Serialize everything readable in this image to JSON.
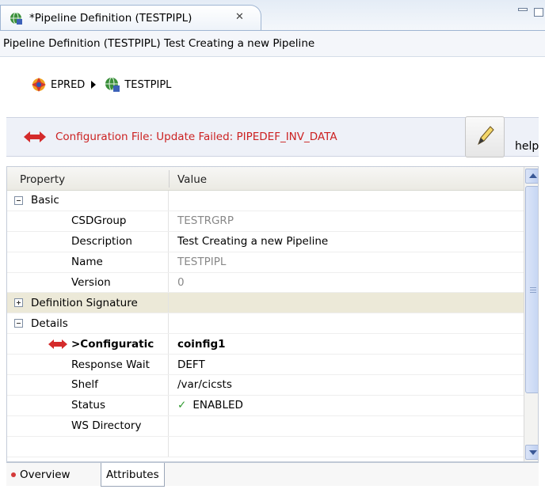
{
  "tab": {
    "title": "*Pipeline Definition (TESTPIPL)",
    "close_icon": "close-icon"
  },
  "editor_header": "Pipeline Definition (TESTPIPL) Test Creating a new Pipeline",
  "breadcrumb": {
    "items": [
      {
        "label": "EPRED",
        "icon": "region-icon"
      },
      {
        "label": "TESTPIPL",
        "icon": "pipeline-icon"
      }
    ]
  },
  "message": {
    "text": "Configuration File: Update Failed: PIPEDEF_INV_DATA",
    "color": "#cc2222",
    "help_label": "help"
  },
  "table": {
    "headers": {
      "property": "Property",
      "value": "Value"
    },
    "rows": [
      {
        "type": "group",
        "label": "Basic",
        "expanded": true
      },
      {
        "type": "item",
        "label": "CSDGroup",
        "value": "TESTRGRP",
        "muted": true
      },
      {
        "type": "item",
        "label": "Description",
        "value": "Test Creating a new Pipeline"
      },
      {
        "type": "item",
        "label": "Name",
        "value": "TESTPIPL",
        "muted": true
      },
      {
        "type": "item",
        "label": "Version",
        "value": "0",
        "muted": true
      },
      {
        "type": "group",
        "label": "Definition Signature",
        "expanded": false
      },
      {
        "type": "group",
        "label": "Details",
        "expanded": true
      },
      {
        "type": "item",
        "label": ">Configuratic",
        "value": "coinfig1",
        "error": true
      },
      {
        "type": "item",
        "label": "Response Wait",
        "value": "DEFT"
      },
      {
        "type": "item",
        "label": "Shelf",
        "value": "/var/cicsts"
      },
      {
        "type": "item",
        "label": "Status",
        "value": "ENABLED",
        "check": true
      },
      {
        "type": "item",
        "label": "WS Directory",
        "value": ""
      }
    ]
  },
  "bottom_tabs": {
    "overview": "Overview",
    "attributes": "Attributes"
  }
}
